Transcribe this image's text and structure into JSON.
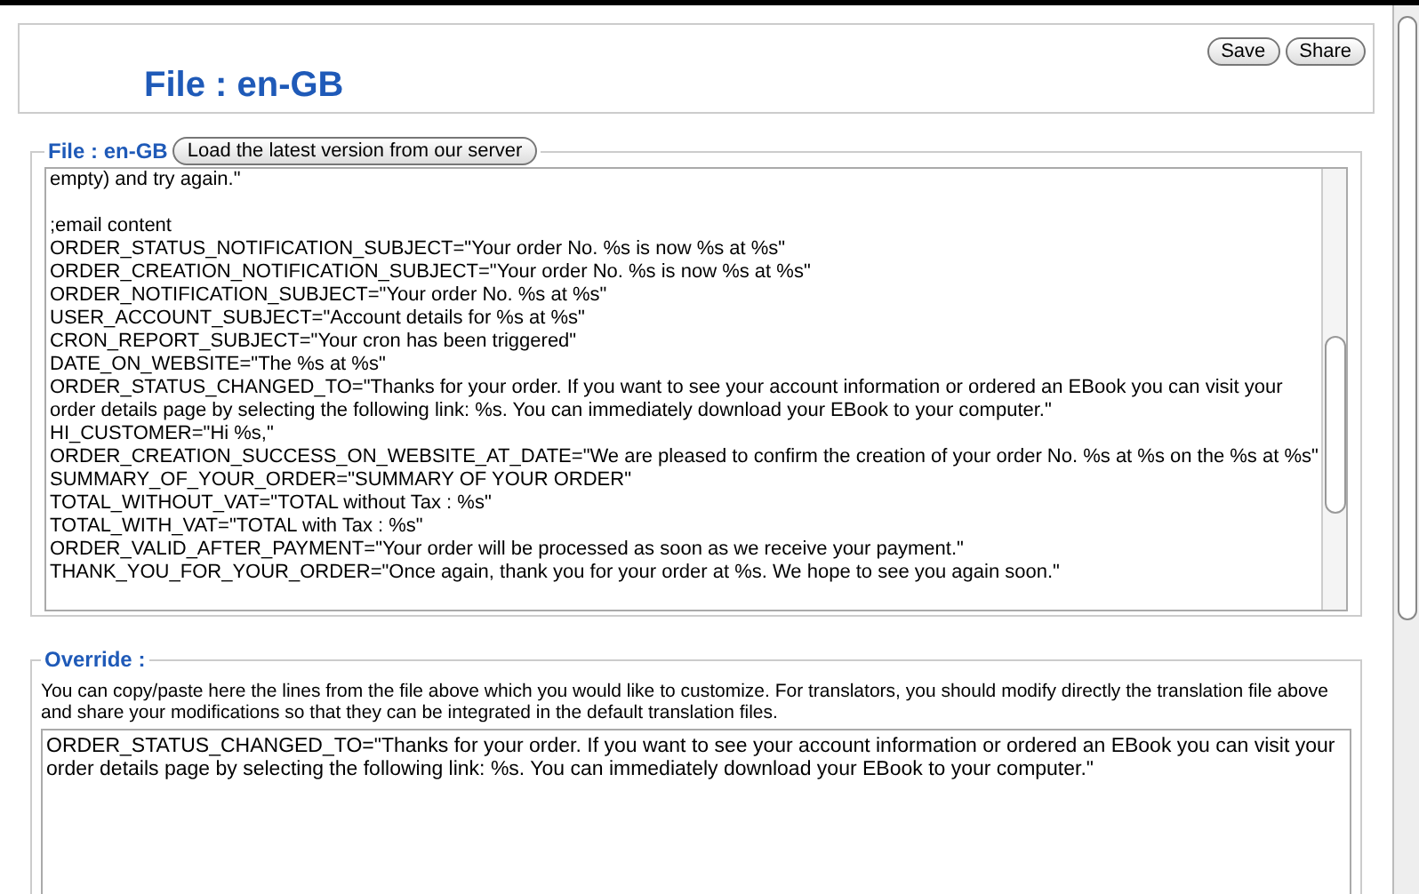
{
  "header": {
    "title": "File : en-GB",
    "buttons": [
      "Save",
      "Share"
    ]
  },
  "file_section": {
    "legend": "File : en-GB",
    "load_button": "Load the latest version from our server",
    "blocks": [
      [
        "empty) and try again.\""
      ],
      [
        ";email content",
        "ORDER_STATUS_NOTIFICATION_SUBJECT=\"Your order No. %s is now %s at %s\"",
        "ORDER_CREATION_NOTIFICATION_SUBJECT=\"Your order No. %s is now %s at %s\"",
        "ORDER_NOTIFICATION_SUBJECT=\"Your order No. %s at %s\"",
        "USER_ACCOUNT_SUBJECT=\"Account details for %s at %s\"",
        "CRON_REPORT_SUBJECT=\"Your cron has been triggered\"",
        "DATE_ON_WEBSITE=\"The %s at %s\"",
        "ORDER_STATUS_CHANGED_TO=\"Thanks for your order. If you want to see your account information or ordered an EBook you can visit your order details page by selecting the following link: %s. You can immediately download your EBook to your computer.\"",
        "HI_CUSTOMER=\"Hi %s,\"",
        "ORDER_CREATION_SUCCESS_ON_WEBSITE_AT_DATE=\"We are pleased to confirm the creation of your order No. %s at %s on the %s at %s\"",
        "SUMMARY_OF_YOUR_ORDER=\"SUMMARY OF YOUR ORDER\"",
        "TOTAL_WITHOUT_VAT=\"TOTAL without Tax : %s\"",
        "TOTAL_WITH_VAT=\"TOTAL with Tax : %s\"",
        "ORDER_VALID_AFTER_PAYMENT=\"Your order will be processed as soon as we receive your payment.\"",
        "THANK_YOU_FOR_YOUR_ORDER=\"Once again, thank you for your order at %s. We hope to see you again soon.\""
      ]
    ]
  },
  "override_section": {
    "legend": "Override :",
    "description": "You can copy/paste here the lines from the file above which you would like to customize. For translators, you should modify directly the translation file above and share your modifications so that they can be integrated in the default translation files.",
    "value": "ORDER_STATUS_CHANGED_TO=\"Thanks for your order. If you want to see your account information or ordered an EBook you can visit your order details page by selecting the following link: %s. You can immediately download your EBook to your computer.\""
  }
}
